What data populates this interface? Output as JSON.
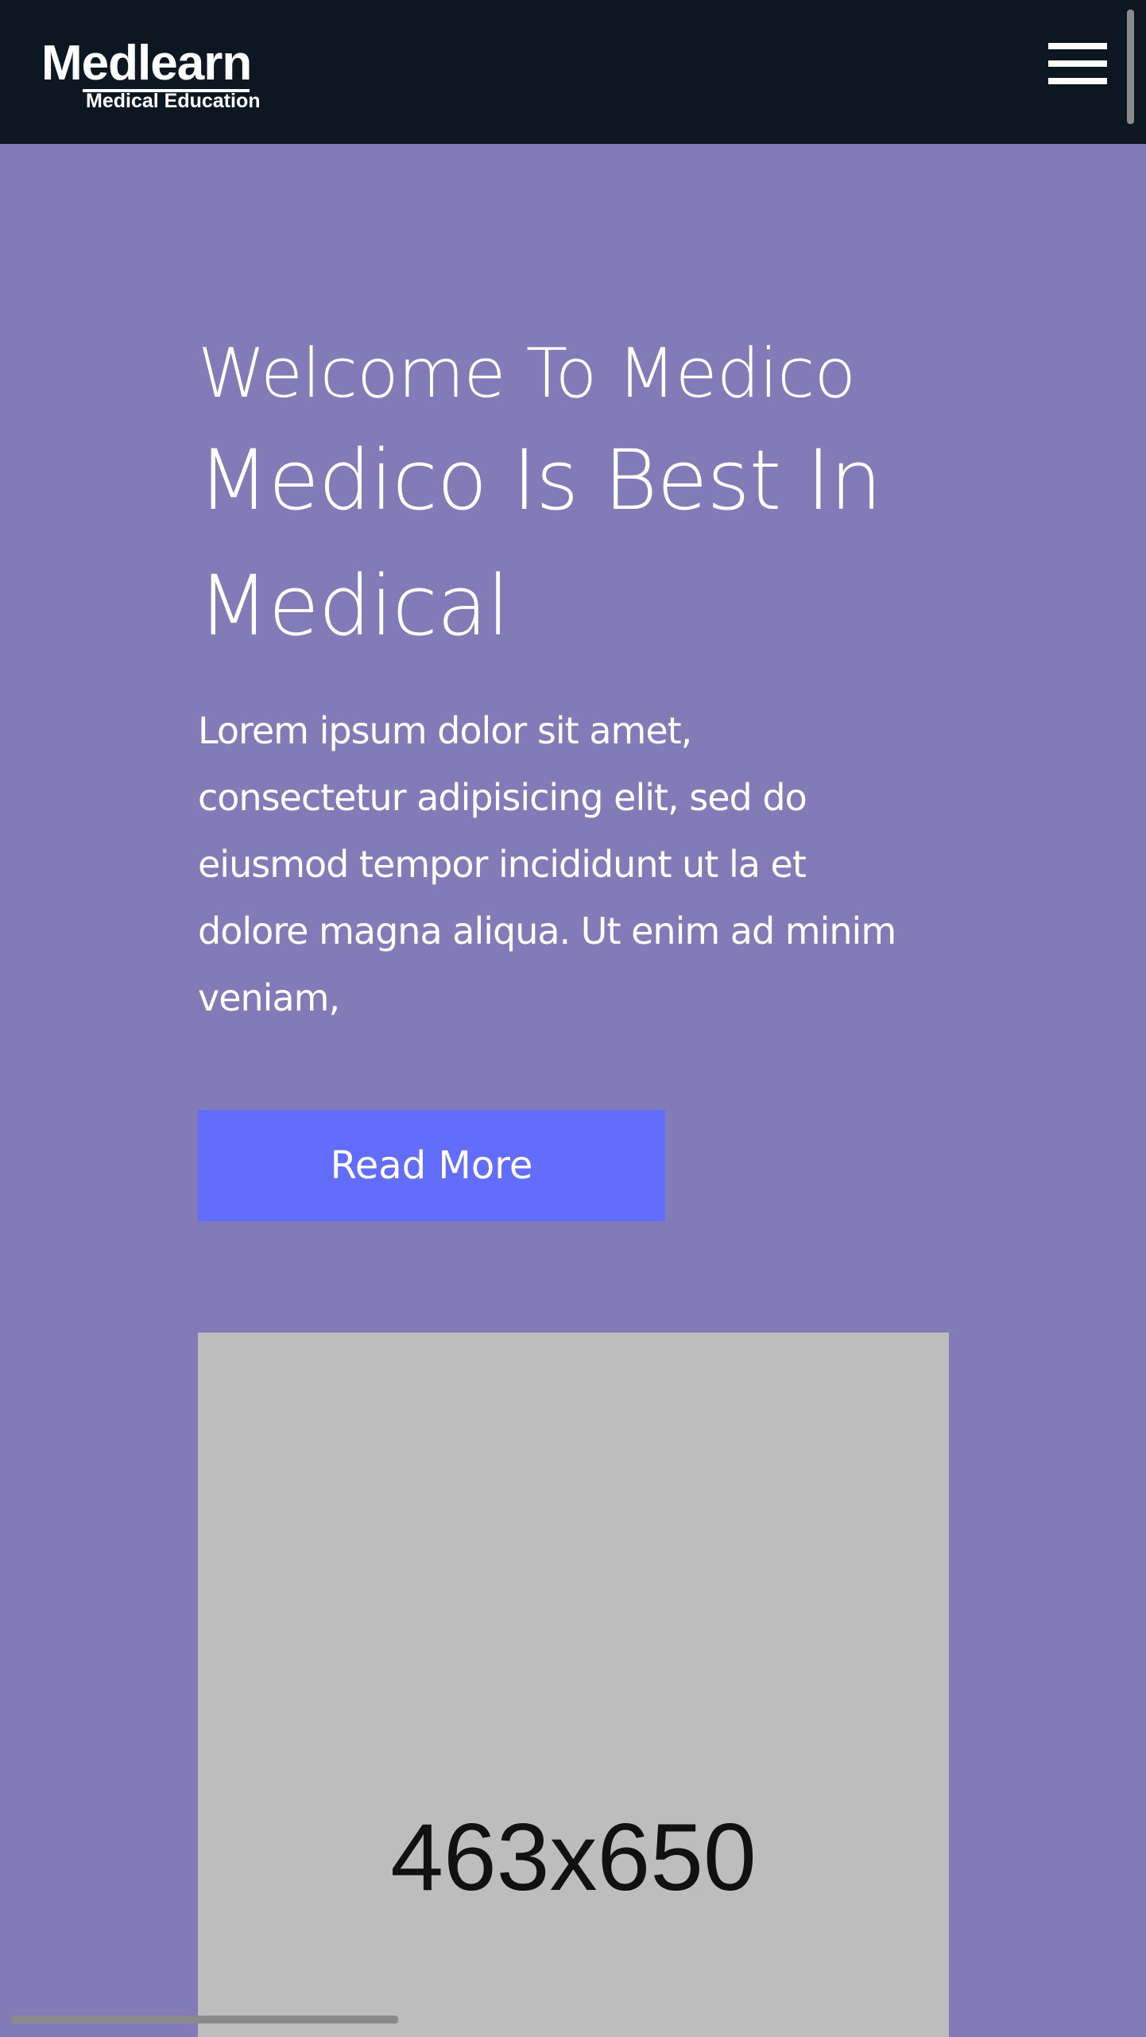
{
  "header": {
    "logo_main": "Medlearn",
    "logo_sub": "Medical Education",
    "menu_icon": "hamburger-menu-icon",
    "background_color": "#0c1722"
  },
  "hero": {
    "greeting": "Welcome To Medico",
    "title": "Medico Is Best In Medical",
    "description": "Lorem ipsum dolor sit amet, consectetur adipisicing elit, sed do eiusmod tempor incididunt ut la et dolore magna aliqua. Ut enim ad minim veniam,",
    "button_label": "Read More",
    "background_color": "#837bb8",
    "button_color": "#636dfb"
  },
  "image_placeholder": {
    "label": "463x650"
  }
}
